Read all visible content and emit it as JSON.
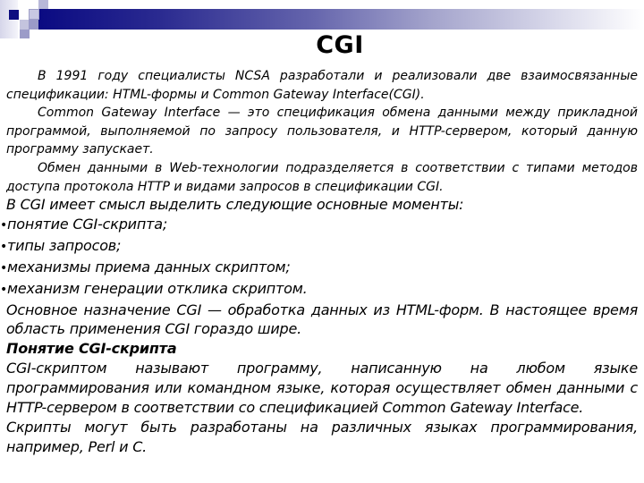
{
  "slide": {
    "title": "CGI",
    "intro_paragraphs": [
      "В 1991 году специалисты NCSA разработали и реализовали две взаимосвязанные спецификации: HTML-формы и Common Gateway Interface(CGI).",
      "Common Gateway Interface — это спецификация обмена данными между прикладной программой, выполняемой по запросу пользователя, и HTTP-сервером, который данную программу запускает.",
      "Обмен данными в Web-технологии подразделяется в соответствии с типами методов доступа протокола HTTP и видами запросов в спецификации CGI."
    ],
    "lead": "В CGI имеет смысл выделить следующие основные моменты:",
    "bullet_glyph": "•",
    "bullets": [
      "понятие CGI-скрипта;",
      "типы запросов;",
      "механизмы приема данных скриптом;",
      "механизм генерации отклика скриптом."
    ],
    "purpose_paragraph": "Основное назначение CGI — обработка данных из HTML-форм. В настоящее время область применения CGI гораздо шире.",
    "subheading": "Понятие CGI-скрипта",
    "definition_paragraph": "CGI-скриптом называют программу, написанную на любом языке программирования или командном языке, которая осуществляет обмен данными с HTTP-сервером в соответствии со спецификацией Common Gateway Interface.",
    "languages_paragraph": "Скрипты могут быть разработаны на различных языках программирования, например, Perl и C."
  },
  "theme": {
    "accent_dark": "#0a0a82",
    "accent_light": "#d8d8ea",
    "text_color": "#000000"
  }
}
